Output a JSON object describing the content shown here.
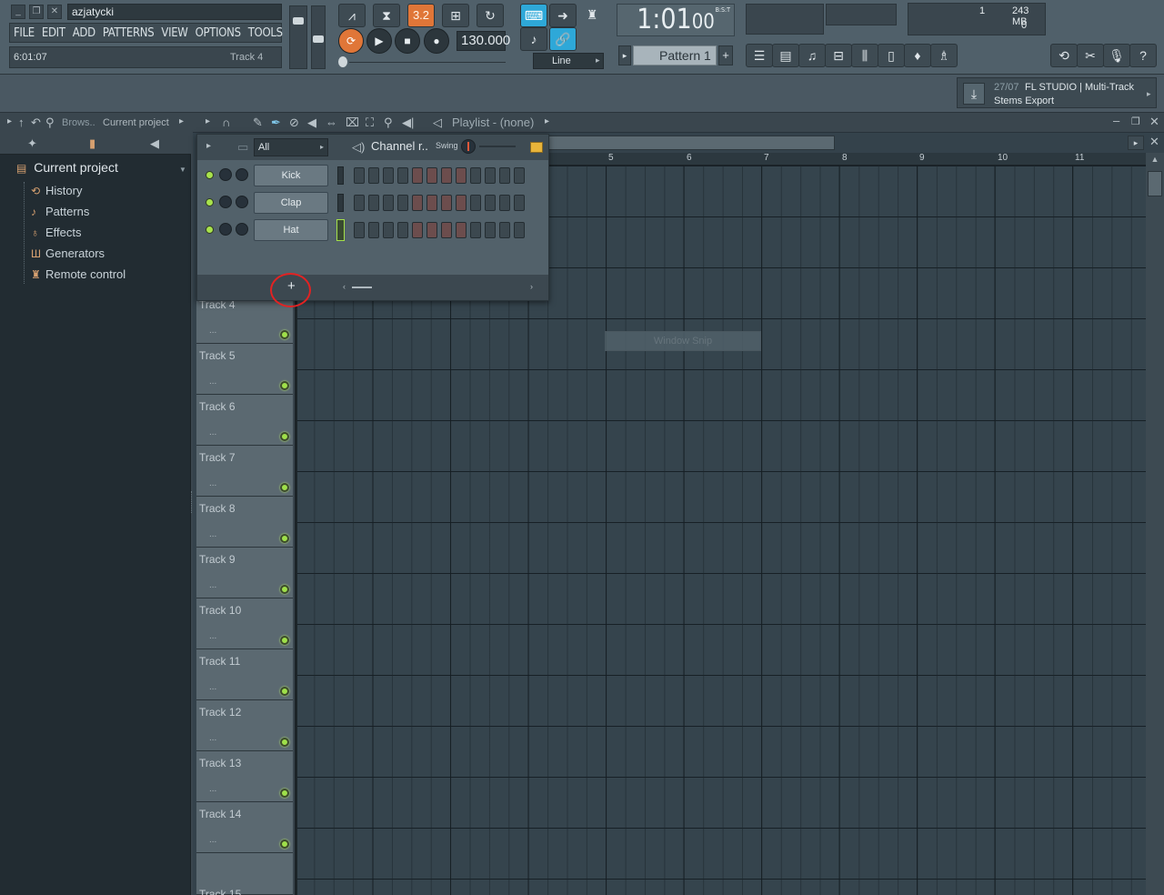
{
  "window": {
    "title_field": "azjatycki",
    "hint_left": "6:01:07",
    "hint_right": "Track 4"
  },
  "menu": [
    "FILE",
    "EDIT",
    "ADD",
    "PATTERNS",
    "VIEW",
    "OPTIONS",
    "TOOLS",
    "?"
  ],
  "transport": {
    "pattern_song_mode": "3.2",
    "tempo": "130.000",
    "time": "1:01",
    "time_small": "00",
    "time_label": "B:S:T",
    "snap_mode": "Line",
    "pattern": "Pattern 1",
    "cpu_value": "1",
    "memory": "243 MB",
    "polyphony": "0"
  },
  "news": {
    "date": "27/07",
    "line1": "FL STUDIO | Multi-Track",
    "line2": "Stems Export"
  },
  "browser": {
    "tab_browse": "Brows..",
    "tab_project": "Current project",
    "root": "Current project",
    "items": [
      {
        "label": "History",
        "icon": "history-icon"
      },
      {
        "label": "Patterns",
        "icon": "note-icon"
      },
      {
        "label": "Effects",
        "icon": "plug-icon"
      },
      {
        "label": "Generators",
        "icon": "keyboard-icon"
      },
      {
        "label": "Remote control",
        "icon": "remote-icon"
      }
    ]
  },
  "playlist": {
    "title": "Playlist - (none)",
    "bars": [
      "5",
      "6",
      "7",
      "8",
      "9",
      "10",
      "11"
    ],
    "tracks": [
      "Track 4",
      "Track 5",
      "Track 6",
      "Track 7",
      "Track 8",
      "Track 9",
      "Track 10",
      "Track 11",
      "Track 12",
      "Track 13",
      "Track 14",
      "Track 15"
    ],
    "dots": "..."
  },
  "channel_rack": {
    "filter": "All",
    "title": "Channel r..",
    "swing_label": "Swing",
    "add_label": "+",
    "channels": [
      {
        "name": "Kick"
      },
      {
        "name": "Clap"
      },
      {
        "name": "Hat"
      }
    ]
  },
  "overlay": {
    "snip_label": "Window Snip"
  }
}
